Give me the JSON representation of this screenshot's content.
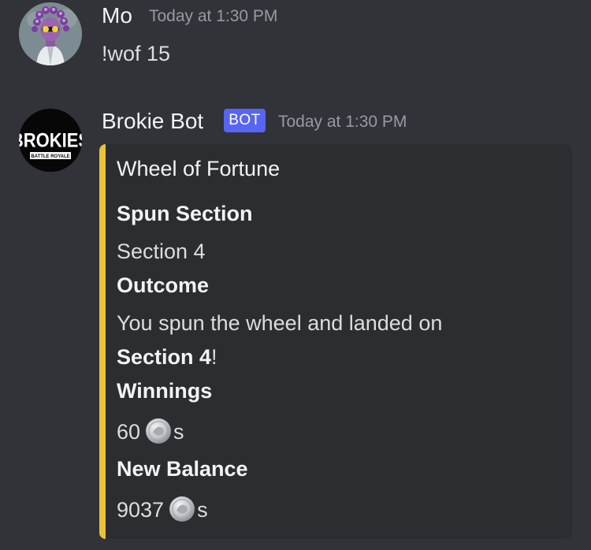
{
  "messages": [
    {
      "username": "Mo",
      "timestamp": "Today at 1:30 PM",
      "text": "!wof 15"
    },
    {
      "username": "Brokie Bot",
      "badge": "BOT",
      "timestamp": "Today at 1:30 PM",
      "avatar_logo": "BROKIES",
      "avatar_subtitle": "BATTLE ROYALE",
      "embed": {
        "accent_color": "#eac23a",
        "title": "Wheel of Fortune",
        "spun_section": {
          "name": "Spun Section",
          "value": "Section 4"
        },
        "outcome": {
          "name": "Outcome",
          "line1": "You spun the wheel and landed on",
          "line2_bold": "Section 4",
          "line2_suffix": "!"
        },
        "winnings": {
          "name": "Winnings",
          "amount": "60",
          "suffix": "s",
          "icon": "silver-coin-icon"
        },
        "new_balance": {
          "name": "New Balance",
          "amount": "9037",
          "suffix": "s",
          "icon": "silver-coin-icon"
        }
      }
    }
  ],
  "colors": {
    "background": "#313338",
    "embed_background": "#2b2d31",
    "bot_badge": "#5865f2",
    "timestamp": "#949ba4"
  }
}
